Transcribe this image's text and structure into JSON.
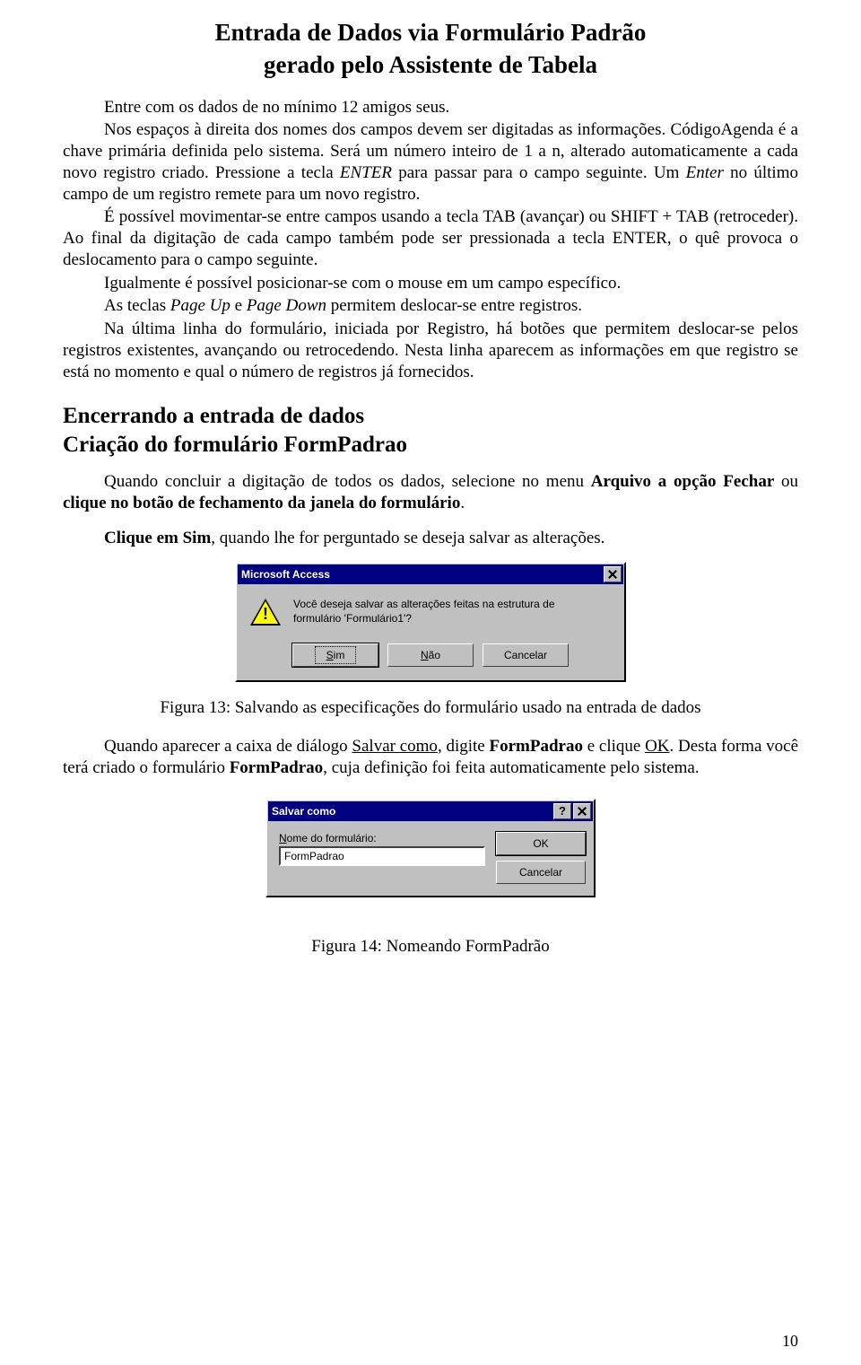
{
  "title": "Entrada de Dados via Formulário Padrão",
  "subtitle": "gerado pelo Assistente de Tabela",
  "p1_a": "Entre com os dados de no mínimo 12 amigos seus.",
  "p2_a": "Nos espaços  à direita dos nomes dos campos devem ser digitadas as informações. CódigoAgenda é a chave primária definida pelo sistema. Será um número inteiro de 1 a n, alterado automaticamente a cada novo registro criado. Pressione a tecla ",
  "p2_b": "ENTER",
  "p2_c": " para passar para o  campo seguinte. Um ",
  "p2_d": "Enter",
  "p2_e": " no último campo de um registro remete para um novo registro.",
  "p3": "É possível movimentar-se entre campos usando a tecla TAB (avançar) ou SHIFT + TAB (retroceder). Ao final da digitação de cada campo também pode ser pressionada a tecla ENTER, o quê provoca o deslocamento para o campo seguinte.",
  "p4": "Igualmente é possível posicionar-se com o mouse em um campo específico.",
  "p5_a": "As teclas ",
  "p5_b": "Page Up",
  "p5_c": " e ",
  "p5_d": "Page Down",
  "p5_e": " permitem deslocar-se entre registros.",
  "p6": "Na última linha do formulário, iniciada por Registro, há botões que permitem deslocar-se pelos registros existentes, avançando ou retrocedendo. Nesta linha aparecem as informações em que registro se está no momento e qual o número de registros já fornecidos.",
  "h2a": "Encerrando a entrada de dados",
  "h2b": "Criação do formulário FormPadrao",
  "p7_a": "Quando concluir a digitação de todos os dados, selecione no menu ",
  "p7_b": "Arquivo a opção Fechar",
  "p7_c": " ou ",
  "p7_d": "clique no botão de fechamento da janela do formulário",
  "p7_e": ".",
  "p8_a": "Clique em Sim",
  "p8_b": ", quando lhe for perguntado se deseja salvar as alterações.",
  "dialog1": {
    "title": "Microsoft Access",
    "message": "Você deseja salvar as alterações feitas na estrutura de formulário 'Formulário1'?",
    "buttons": {
      "yes_u": "S",
      "yes_rest": "im",
      "no_u": "N",
      "no_rest": "ão",
      "cancel": "Cancelar"
    }
  },
  "caption1": "Figura  13:  Salvando as especificações do formulário usado na entrada de dados",
  "p9_a": "Quando aparecer a caixa de diálogo ",
  "p9_b": "Salvar como",
  "p9_c": ", digite ",
  "p9_d": "FormPadrao",
  "p9_e": " e clique ",
  "p9_f": "OK",
  "p9_g": ". Desta forma você terá criado o formulário ",
  "p9_h": "FormPadrao",
  "p9_i": ", cuja definição foi feita automaticamente pelo sistema.",
  "dialog2": {
    "title": "Salvar como",
    "label_u": "N",
    "label_rest": "ome do formulário:",
    "input_value": "FormPadrao",
    "ok": "OK",
    "cancel": "Cancelar"
  },
  "caption2": "Figura   14: Nomeando FormPadrão",
  "page_number": "10"
}
